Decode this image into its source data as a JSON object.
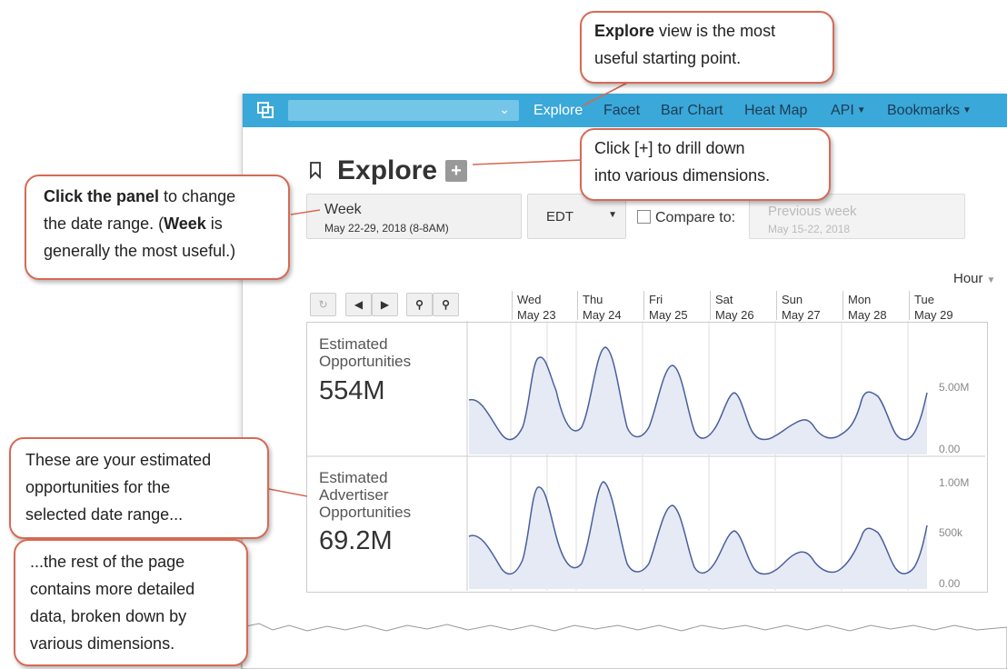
{
  "app": {
    "nav": [
      {
        "label": "Explore",
        "active": true
      },
      {
        "label": "Facet"
      },
      {
        "label": "Bar Chart"
      },
      {
        "label": "Heat Map"
      },
      {
        "label": "API",
        "dropdown": true
      },
      {
        "label": "Bookmarks",
        "dropdown": true
      }
    ],
    "page_title": "Explore",
    "add_dimension_label": "+",
    "date_panel": {
      "title": "Week",
      "range": "May 22-29, 2018 (8-8AM)"
    },
    "timezone": "EDT",
    "compare_label": "Compare to:",
    "compare_panel": {
      "title": "Previous week",
      "range": "May 15-22, 2018"
    },
    "granularity": "Hour",
    "days": [
      {
        "dow": "Wed",
        "date": "May 23"
      },
      {
        "dow": "Thu",
        "date": "May 24"
      },
      {
        "dow": "Fri",
        "date": "May 25"
      },
      {
        "dow": "Sat",
        "date": "May 26"
      },
      {
        "dow": "Sun",
        "date": "May 27"
      },
      {
        "dow": "Mon",
        "date": "May 28"
      },
      {
        "dow": "Tue",
        "date": "May 29"
      }
    ],
    "metrics": [
      {
        "label_lines": [
          "Estimated",
          "Opportunities"
        ],
        "value": "554M",
        "y_labels": [
          "5.00M",
          "0.00"
        ]
      },
      {
        "label_lines": [
          "Estimated",
          "Advertiser",
          "Opportunities"
        ],
        "value": "69.2M",
        "y_labels": [
          "1.00M",
          "500k",
          "0.00"
        ]
      }
    ]
  },
  "callouts": {
    "explore": {
      "bold": "Explore",
      "rest1": " view is the most",
      "line2": "useful starting point."
    },
    "plus": {
      "line1": "Click [+] to drill down",
      "line2": "into various dimensions."
    },
    "panel": {
      "bold": "Click the panel",
      "rest1": " to change",
      "line2a": "the date range. (",
      "line2b": "Week",
      "line2c": " is",
      "line3": "generally the most useful.)"
    },
    "estimated": {
      "line1": "These are your estimated",
      "line2": "opportunities for the",
      "line3": "selected date range..."
    },
    "rest": {
      "line1": "...the rest of the page",
      "line2": "contains more detailed",
      "line3": "data, broken down by",
      "line4": "various dimensions."
    }
  },
  "colors": {
    "topbar": "#3aa8d8",
    "callout_border": "#d66a55",
    "chart_line": "#4a5f9c",
    "chart_fill": "#e6eaf4"
  }
}
